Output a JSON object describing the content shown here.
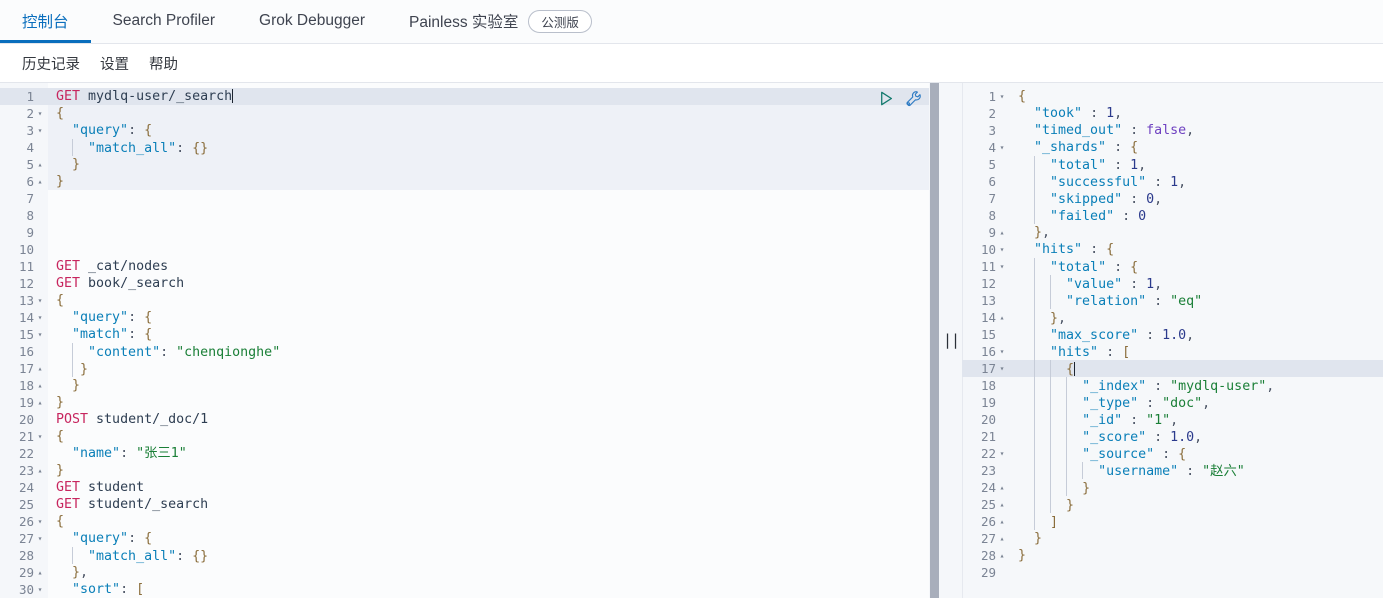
{
  "header": {
    "tabs": [
      {
        "label": "控制台",
        "active": true
      },
      {
        "label": "Search Profiler",
        "active": false
      },
      {
        "label": "Grok Debugger",
        "active": false
      },
      {
        "label": "Painless 实验室",
        "active": false
      }
    ],
    "badge": "公测版",
    "submenu": [
      "历史记录",
      "设置",
      "帮助"
    ]
  },
  "icons": {
    "play": "play-icon",
    "wrench": "wrench-icon",
    "splitter": "resize-handle-icon"
  },
  "colors": {
    "accent": "#0a6ebd",
    "method": "#c7255e",
    "key": "#0a7fb8",
    "string": "#1a7f37",
    "number": "#2b3a8c",
    "boolean": "#6f42c1",
    "highlight": "#e0e5ee",
    "request_block": "#eef1f7",
    "scrollbar": "#a8aebb"
  },
  "editor": {
    "name": "request-editor",
    "cursor_line": 1,
    "active_request_lines": [
      1,
      6
    ],
    "total_lines": 30,
    "lines": [
      {
        "n": 1,
        "fold": "",
        "text": "GET mydlq-user/_search"
      },
      {
        "n": 2,
        "fold": "▾",
        "text": "{"
      },
      {
        "n": 3,
        "fold": "▾",
        "text": "  \"query\": {"
      },
      {
        "n": 4,
        "fold": "",
        "text": "    \"match_all\": {}"
      },
      {
        "n": 5,
        "fold": "▴",
        "text": "  }"
      },
      {
        "n": 6,
        "fold": "▴",
        "text": "}"
      },
      {
        "n": 7,
        "fold": "",
        "text": ""
      },
      {
        "n": 8,
        "fold": "",
        "text": ""
      },
      {
        "n": 9,
        "fold": "",
        "text": ""
      },
      {
        "n": 10,
        "fold": "",
        "text": ""
      },
      {
        "n": 11,
        "fold": "",
        "text": "GET _cat/nodes"
      },
      {
        "n": 12,
        "fold": "",
        "text": "GET book/_search"
      },
      {
        "n": 13,
        "fold": "▾",
        "text": "{"
      },
      {
        "n": 14,
        "fold": "▾",
        "text": "  \"query\": {"
      },
      {
        "n": 15,
        "fold": "▾",
        "text": "  \"match\": {"
      },
      {
        "n": 16,
        "fold": "",
        "text": "    \"content\": \"chenqionghe\""
      },
      {
        "n": 17,
        "fold": "▴",
        "text": "   }"
      },
      {
        "n": 18,
        "fold": "▴",
        "text": "  }"
      },
      {
        "n": 19,
        "fold": "▴",
        "text": "}"
      },
      {
        "n": 20,
        "fold": "",
        "text": "POST student/_doc/1"
      },
      {
        "n": 21,
        "fold": "▾",
        "text": "{"
      },
      {
        "n": 22,
        "fold": "",
        "text": "  \"name\": \"张三1\""
      },
      {
        "n": 23,
        "fold": "▴",
        "text": "}"
      },
      {
        "n": 24,
        "fold": "",
        "text": "GET student"
      },
      {
        "n": 25,
        "fold": "",
        "text": "GET student/_search"
      },
      {
        "n": 26,
        "fold": "▾",
        "text": "{"
      },
      {
        "n": 27,
        "fold": "▾",
        "text": "  \"query\": {"
      },
      {
        "n": 28,
        "fold": "",
        "text": "    \"match_all\": {}"
      },
      {
        "n": 29,
        "fold": "▴",
        "text": "  },"
      },
      {
        "n": 30,
        "fold": "▾",
        "text": "  \"sort\": ["
      }
    ]
  },
  "response": {
    "name": "response-viewer",
    "cursor_line": 17,
    "total_lines": 29,
    "lines": [
      {
        "n": 1,
        "fold": "▾",
        "text": "{"
      },
      {
        "n": 2,
        "fold": "",
        "text": "  \"took\" : 1,"
      },
      {
        "n": 3,
        "fold": "",
        "text": "  \"timed_out\" : false,"
      },
      {
        "n": 4,
        "fold": "▾",
        "text": "  \"_shards\" : {"
      },
      {
        "n": 5,
        "fold": "",
        "text": "    \"total\" : 1,"
      },
      {
        "n": 6,
        "fold": "",
        "text": "    \"successful\" : 1,"
      },
      {
        "n": 7,
        "fold": "",
        "text": "    \"skipped\" : 0,"
      },
      {
        "n": 8,
        "fold": "",
        "text": "    \"failed\" : 0"
      },
      {
        "n": 9,
        "fold": "▴",
        "text": "  },"
      },
      {
        "n": 10,
        "fold": "▾",
        "text": "  \"hits\" : {"
      },
      {
        "n": 11,
        "fold": "▾",
        "text": "    \"total\" : {"
      },
      {
        "n": 12,
        "fold": "",
        "text": "      \"value\" : 1,"
      },
      {
        "n": 13,
        "fold": "",
        "text": "      \"relation\" : \"eq\""
      },
      {
        "n": 14,
        "fold": "▴",
        "text": "    },"
      },
      {
        "n": 15,
        "fold": "",
        "text": "    \"max_score\" : 1.0,"
      },
      {
        "n": 16,
        "fold": "▾",
        "text": "    \"hits\" : ["
      },
      {
        "n": 17,
        "fold": "▾",
        "text": "      {"
      },
      {
        "n": 18,
        "fold": "",
        "text": "        \"_index\" : \"mydlq-user\","
      },
      {
        "n": 19,
        "fold": "",
        "text": "        \"_type\" : \"doc\","
      },
      {
        "n": 20,
        "fold": "",
        "text": "        \"_id\" : \"1\","
      },
      {
        "n": 21,
        "fold": "",
        "text": "        \"_score\" : 1.0,"
      },
      {
        "n": 22,
        "fold": "▾",
        "text": "        \"_source\" : {"
      },
      {
        "n": 23,
        "fold": "",
        "text": "          \"username\" : \"赵六\""
      },
      {
        "n": 24,
        "fold": "▴",
        "text": "        }"
      },
      {
        "n": 25,
        "fold": "▴",
        "text": "      }"
      },
      {
        "n": 26,
        "fold": "▴",
        "text": "    ]"
      },
      {
        "n": 27,
        "fold": "▴",
        "text": "  }"
      },
      {
        "n": 28,
        "fold": "▴",
        "text": "}"
      },
      {
        "n": 29,
        "fold": "",
        "text": ""
      }
    ]
  }
}
